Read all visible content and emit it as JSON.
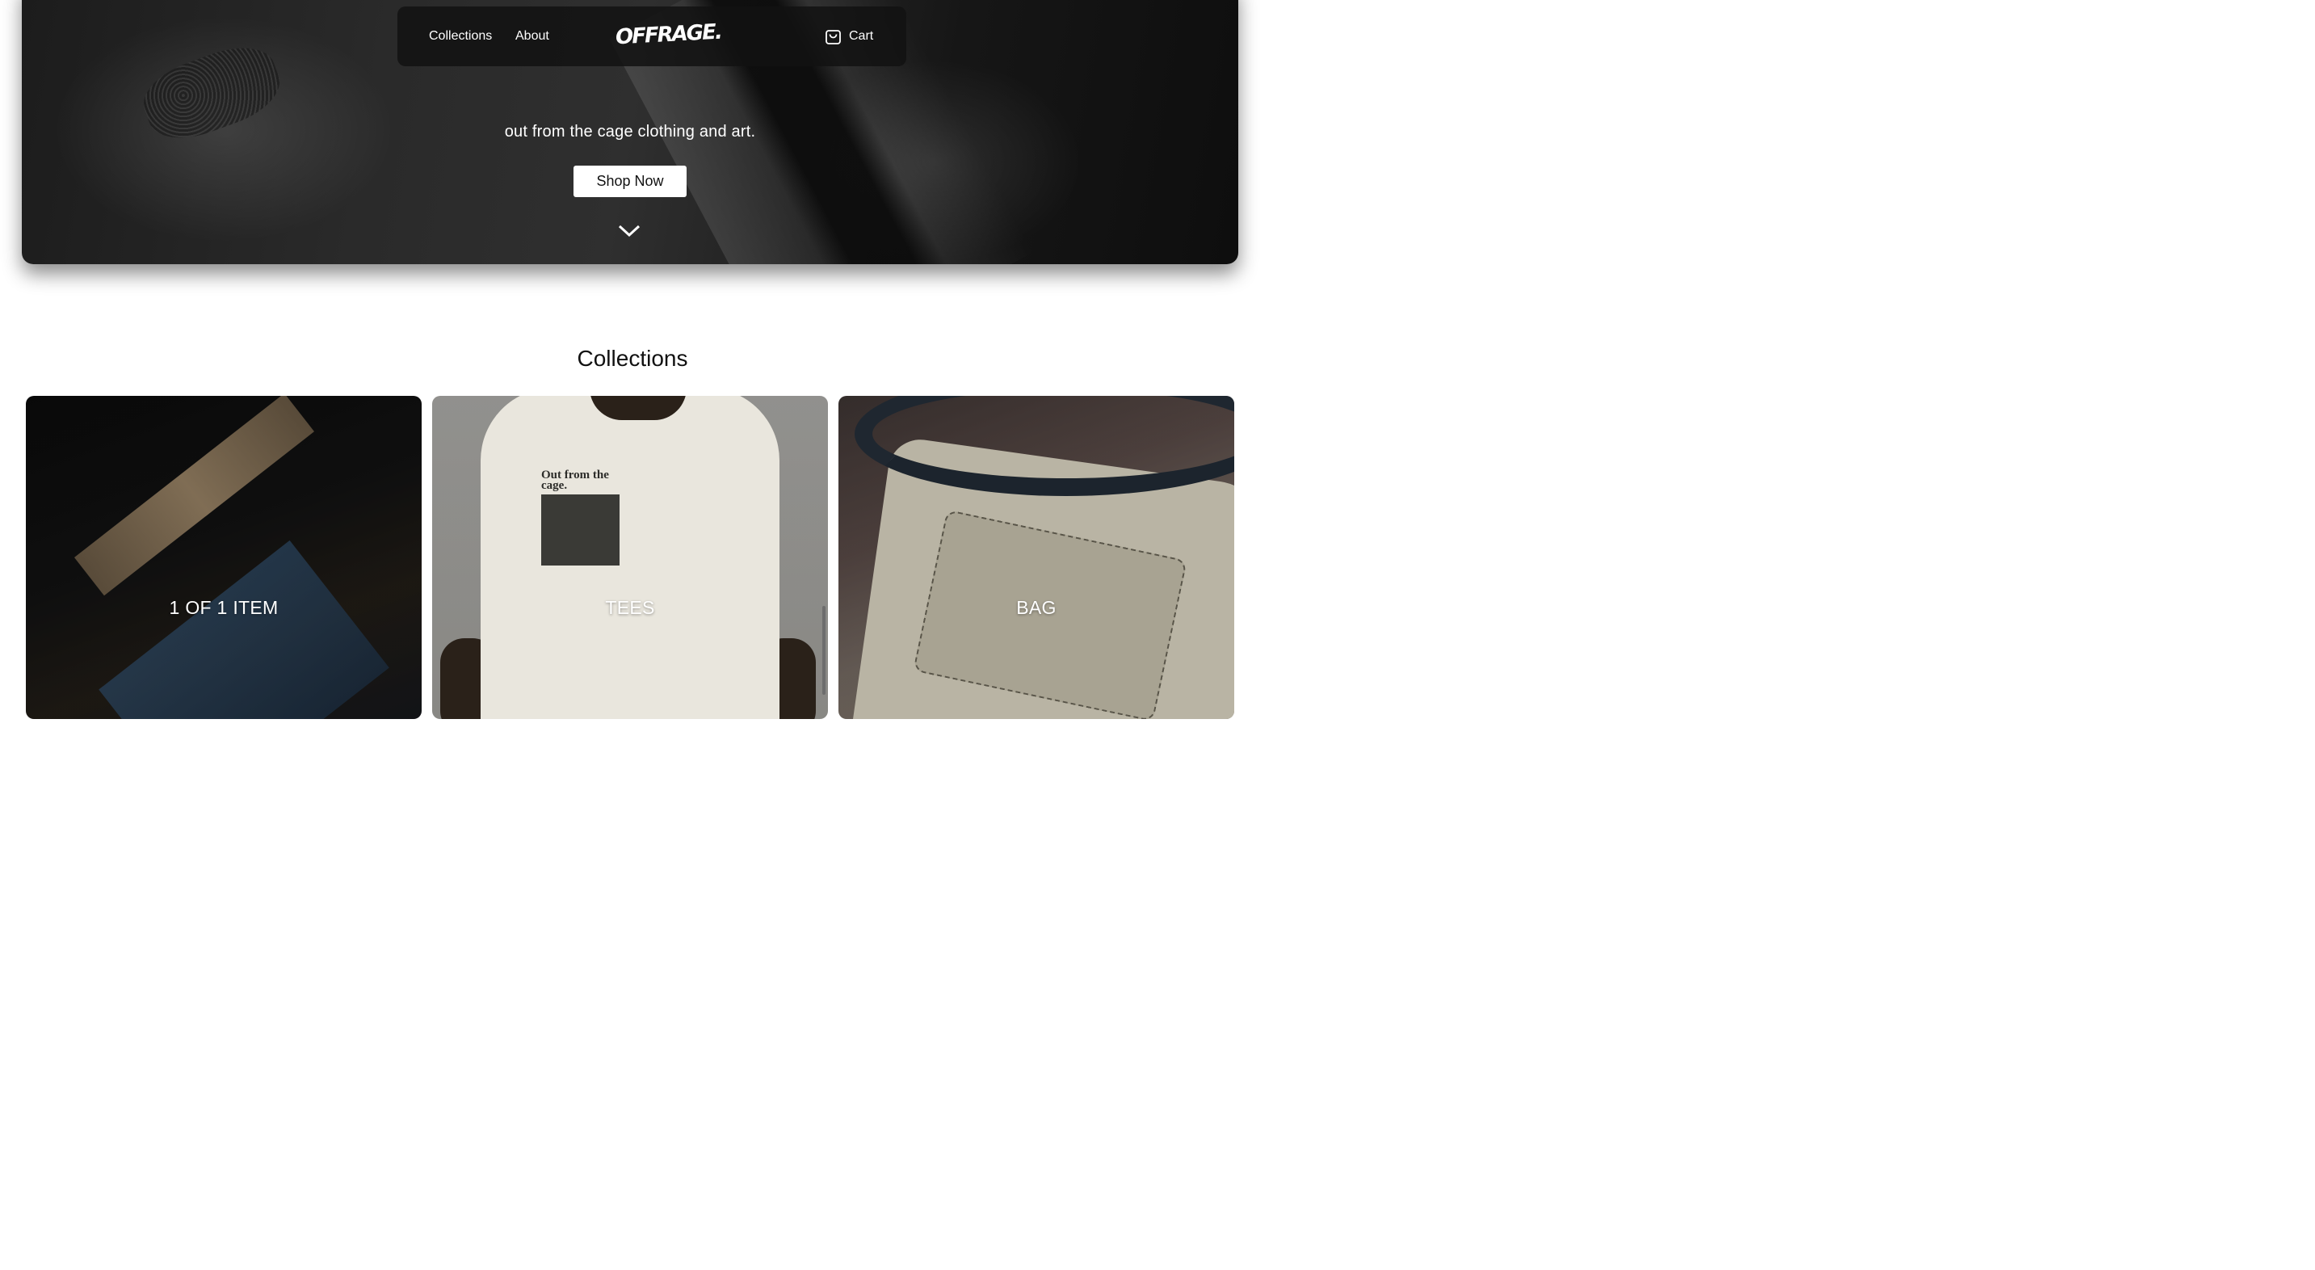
{
  "nav": {
    "collections_label": "Collections",
    "about_label": "About",
    "logo_text": "OFFRAGE.",
    "cart_label": "Cart",
    "cart_icon": "shopping-bag-icon"
  },
  "hero": {
    "tagline": "out from the cage clothing and art.",
    "cta_label": "Shop Now",
    "scroll_icon": "chevron-down-icon"
  },
  "collections": {
    "title": "Collections",
    "items": [
      {
        "label": "1 OF 1 ITEM"
      },
      {
        "label": "TEES",
        "print_text": "Out from the cage."
      },
      {
        "label": "BAG"
      }
    ]
  },
  "colors": {
    "page_background": "#ffffff",
    "hero_overlay": "#1c1c1c",
    "button_background": "#ffffff",
    "text_light": "#ffffff",
    "text_dark": "#111111"
  }
}
